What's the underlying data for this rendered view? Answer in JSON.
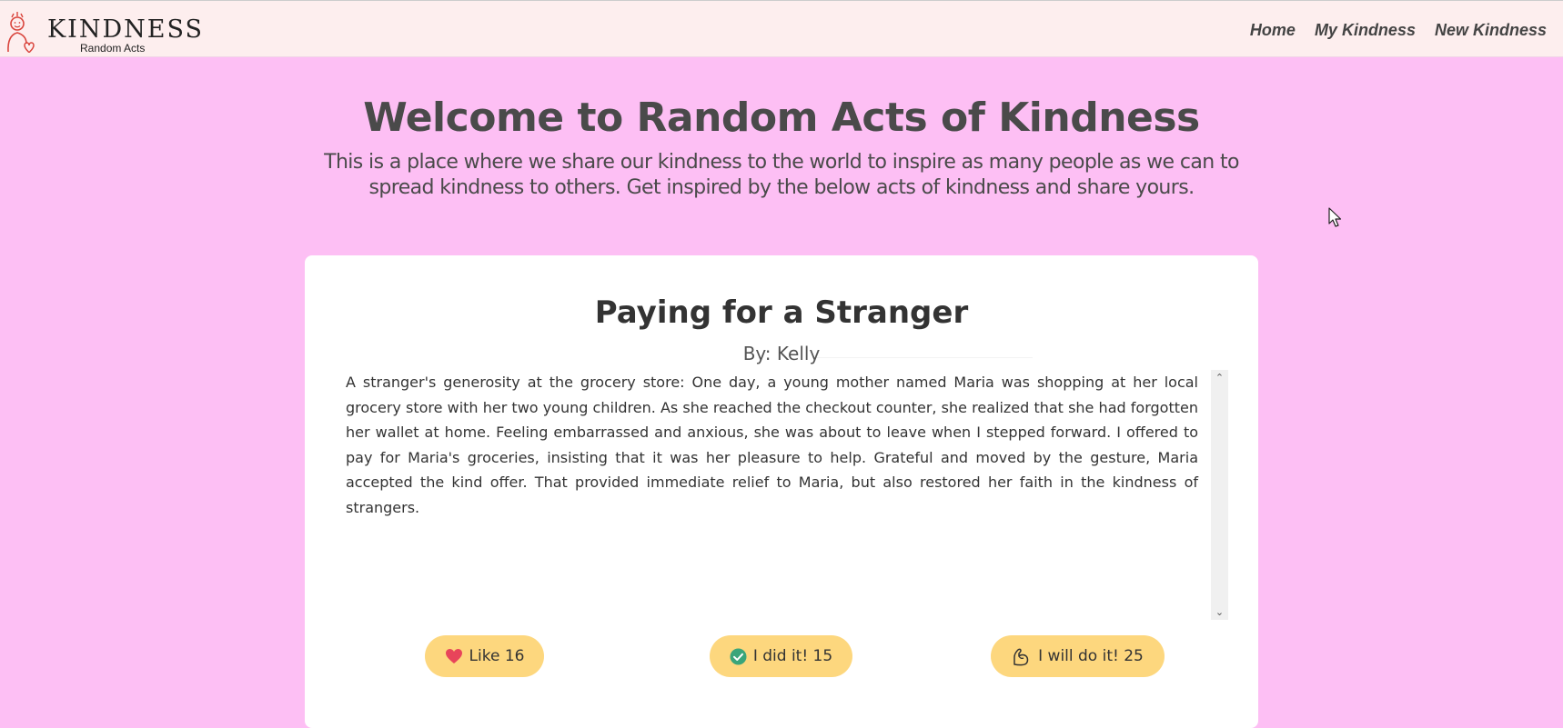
{
  "brand": {
    "title": "KINDNESS",
    "subtitle": "Random Acts"
  },
  "nav": {
    "items": [
      {
        "label": "Home"
      },
      {
        "label": "My Kindness"
      },
      {
        "label": "New Kindness"
      }
    ]
  },
  "hero": {
    "title": "Welcome to Random Acts of Kindness",
    "description": "This is a place where we share our kindness to the world to inspire as many people as we can to spread kindness to others. Get inspired by the below acts of kindness and share yours."
  },
  "card": {
    "title": "Paying for a Stranger",
    "author": "By: Kelly",
    "story": "A stranger's generosity at the grocery store: One day, a young mother named Maria was shopping at her local grocery store with her two young children. As she reached the checkout counter, she realized that she had forgotten her wallet at home. Feeling embarrassed and anxious, she was about to leave when I stepped forward. I offered to pay for Maria's groceries, insisting that it was her pleasure to help. Grateful and moved by the gesture, Maria accepted the kind offer. That provided immediate relief to Maria, but also restored her faith in the kindness of strangers.",
    "actions": {
      "like": {
        "label": "Like 16",
        "icon": "heart-icon"
      },
      "did_it": {
        "label": "I did it! 15",
        "icon": "check-circle-icon"
      },
      "will_do": {
        "label": "I will do it! 25",
        "icon": "flexed-arm-icon"
      }
    }
  },
  "colors": {
    "background": "#fdbff4",
    "navbar": "#fdeeee",
    "button": "#fdd77e",
    "heart": "#e8445a",
    "check": "#3aa57a",
    "logo_accent": "#d9443c"
  }
}
